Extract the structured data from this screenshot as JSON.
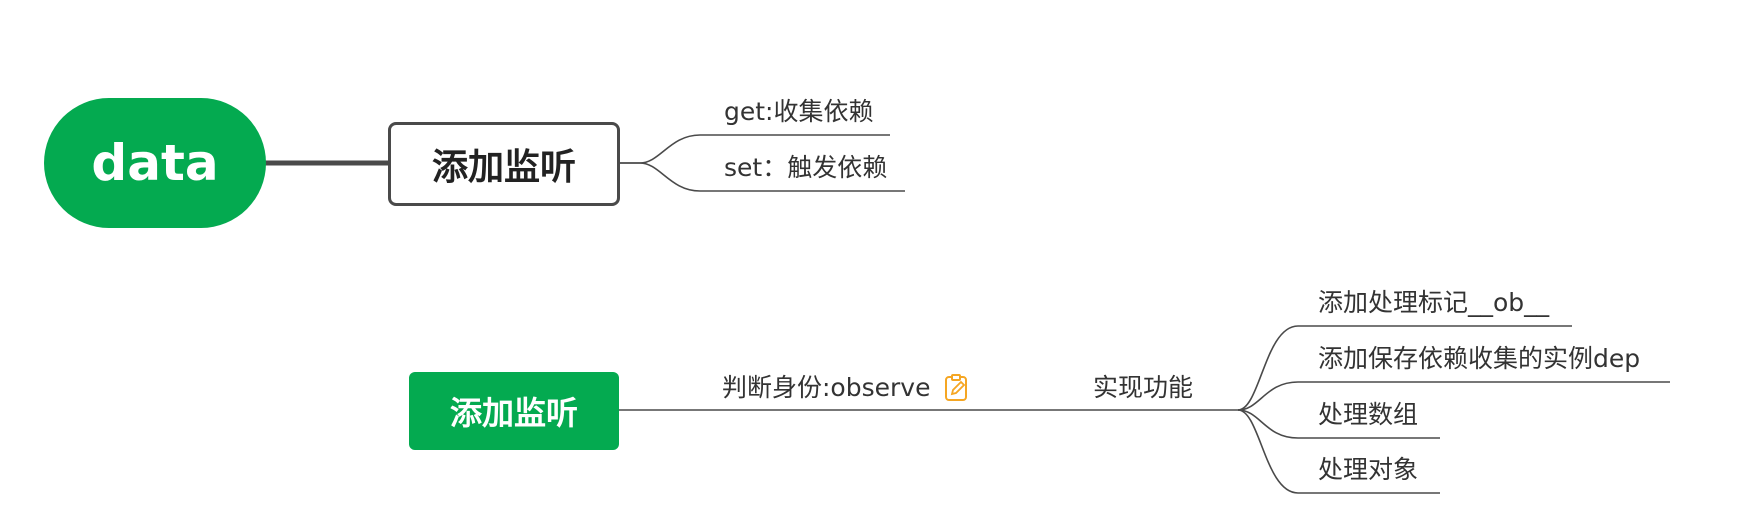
{
  "mindmap_top": {
    "root_label": "data",
    "branch_label": "添加监听",
    "children": [
      "get:收集依赖",
      "set：触发依赖"
    ]
  },
  "mindmap_bottom": {
    "root_label": "添加监听",
    "step1_label": "判断身份:observe",
    "step1_icon": "note-edit-icon",
    "step2_label": "实现功能",
    "children": [
      "添加处理标记__ob__",
      "添加保存依赖收集的实例dep",
      "处理数组",
      "处理对象"
    ]
  },
  "colors": {
    "green": "#04aa50",
    "line": "#4a4a4a",
    "icon": "#f5a623"
  }
}
